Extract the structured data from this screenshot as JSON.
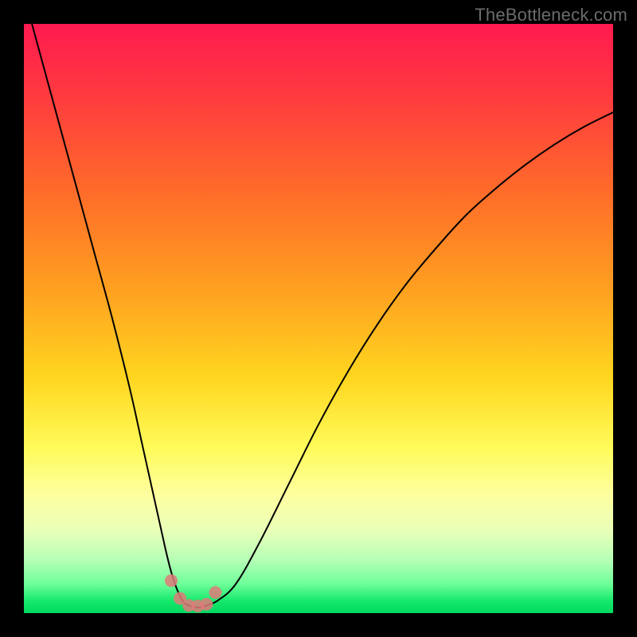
{
  "watermark": "TheBottleneck.com",
  "colors": {
    "curve_stroke": "#000000",
    "marker_fill": "#e07a7a",
    "frame_bg": "#000000"
  },
  "chart_data": {
    "type": "line",
    "title": "",
    "xlabel": "",
    "ylabel": "",
    "xlim": [
      0,
      100
    ],
    "ylim": [
      0,
      100
    ],
    "series": [
      {
        "name": "curve",
        "x": [
          0,
          3,
          6,
          9,
          12,
          15,
          18,
          20,
          22,
          24,
          25,
          26,
          27,
          28,
          29,
          30,
          31,
          33,
          36,
          40,
          45,
          50,
          55,
          60,
          65,
          70,
          75,
          80,
          85,
          90,
          95,
          100
        ],
        "y": [
          105,
          94,
          83,
          72,
          61,
          50,
          38,
          29,
          20,
          11,
          7,
          4,
          2,
          1.3,
          1,
          1,
          1.3,
          2.2,
          5,
          12,
          22,
          32,
          41,
          49,
          56,
          62,
          67.5,
          72,
          76,
          79.5,
          82.5,
          85
        ]
      }
    ],
    "markers": {
      "name": "highlight-points",
      "x": [
        25.0,
        26.5,
        28.0,
        29.5,
        31.0,
        32.5
      ],
      "y": [
        5.5,
        2.5,
        1.3,
        1.2,
        1.5,
        3.5
      ]
    }
  }
}
